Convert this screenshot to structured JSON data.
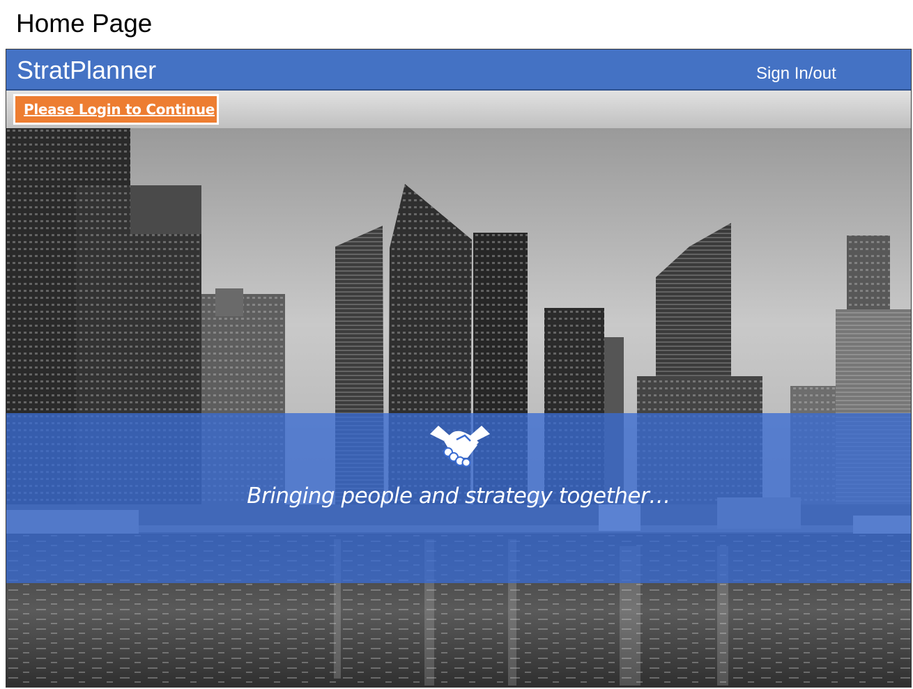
{
  "page": {
    "heading": "Home Page"
  },
  "header": {
    "brand": "StratPlanner",
    "signin_label": "Sign In/out",
    "bar_color": "#4472c4"
  },
  "subbar": {
    "login_label": "Please Login to Continue",
    "login_color": "#ed7d31"
  },
  "hero": {
    "image": "grayscale city skyline with waterfront reflection",
    "banner_icon": "handshake-icon",
    "tagline": "Bringing people and strategy together…",
    "banner_color": "#3a6cd2"
  }
}
